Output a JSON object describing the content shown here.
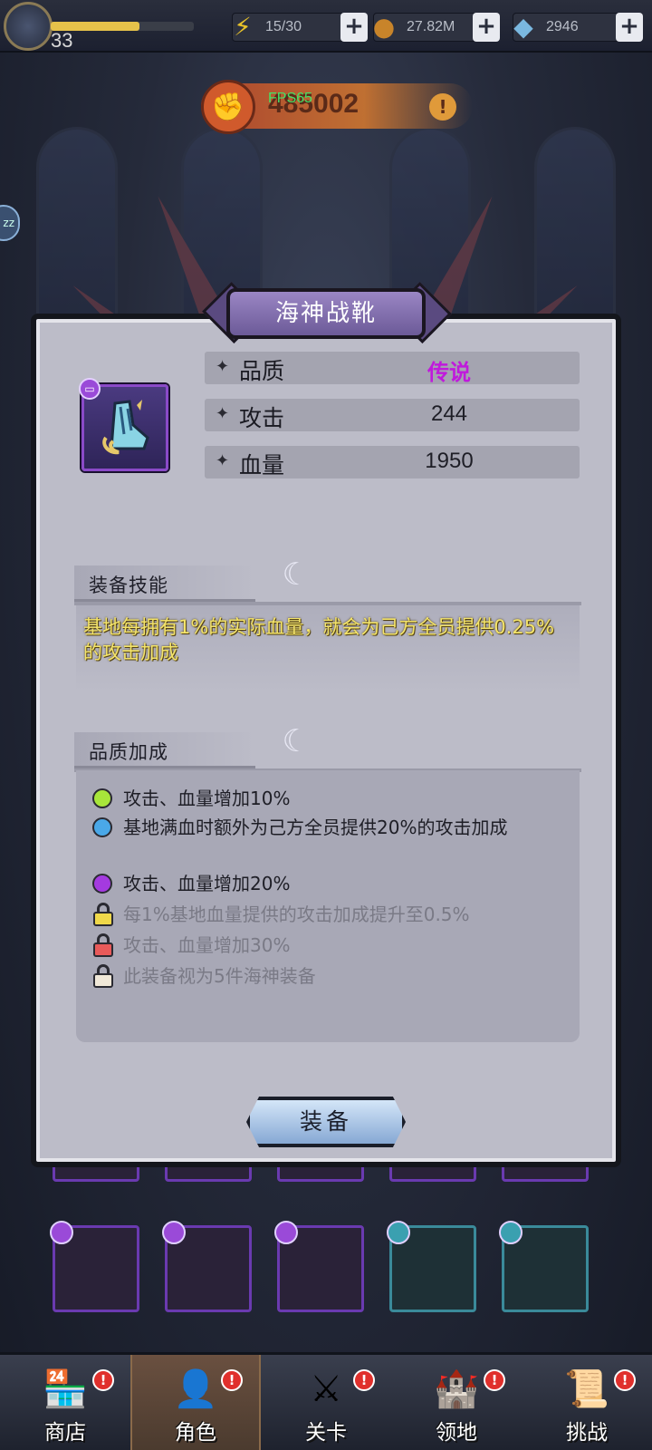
{
  "topbar": {
    "level": "33",
    "xp_progress": 0.62,
    "stamina": "15/30",
    "gold": "27.82M",
    "gems": "2946",
    "plus_label": "+",
    "stamina_icon": "lightning-icon",
    "gold_icon": "coin-icon",
    "gem_icon": "diamond-icon"
  },
  "power": {
    "value": "485002",
    "fps": "FPS65",
    "alert": "!"
  },
  "side_bubble": "zz",
  "dialog": {
    "title": "海神战靴",
    "stats": [
      {
        "label": "品质",
        "value": "传说"
      },
      {
        "label": "攻击",
        "value": "244"
      },
      {
        "label": "血量",
        "value": "1950"
      }
    ],
    "skill_heading": "装备技能",
    "skill_text": "基地每拥有1%的实际血量，就会为己方全员提供0.25%的攻击加成",
    "bonus_heading": "品质加成",
    "bonuses": [
      {
        "text": "攻击、血量增加10%",
        "marker": "dot",
        "color": "#a8e63a"
      },
      {
        "text": "基地满血时额外为己方全员提供20%的攻击加成",
        "marker": "dot",
        "color": "#4aa8e8"
      },
      {
        "text": "攻击、血量增加20%",
        "marker": "dot",
        "color": "#a43ae0"
      },
      {
        "text": "每1%基地血量提供的攻击加成提升至0.5%",
        "marker": "lock",
        "color": "#f0d84a"
      },
      {
        "text": "攻击、血量增加30%",
        "marker": "lock",
        "color": "#e85a5a"
      },
      {
        "text": "此装备视为5件海神装备",
        "marker": "lock",
        "color": "#f0e8d8"
      }
    ],
    "equip_label": "装备"
  },
  "nav": [
    {
      "label": "商店",
      "icon": "shop-icon",
      "badge": "!"
    },
    {
      "label": "角色",
      "icon": "character-icon",
      "badge": "!"
    },
    {
      "label": "关卡",
      "icon": "crossed-swords-icon",
      "badge": "!"
    },
    {
      "label": "领地",
      "icon": "castle-icon",
      "badge": "!"
    },
    {
      "label": "挑战",
      "icon": "scroll-icon",
      "badge": "!"
    }
  ],
  "colors": {
    "legend_purple": "#c01adc",
    "skill_text": "#f4e46a"
  }
}
